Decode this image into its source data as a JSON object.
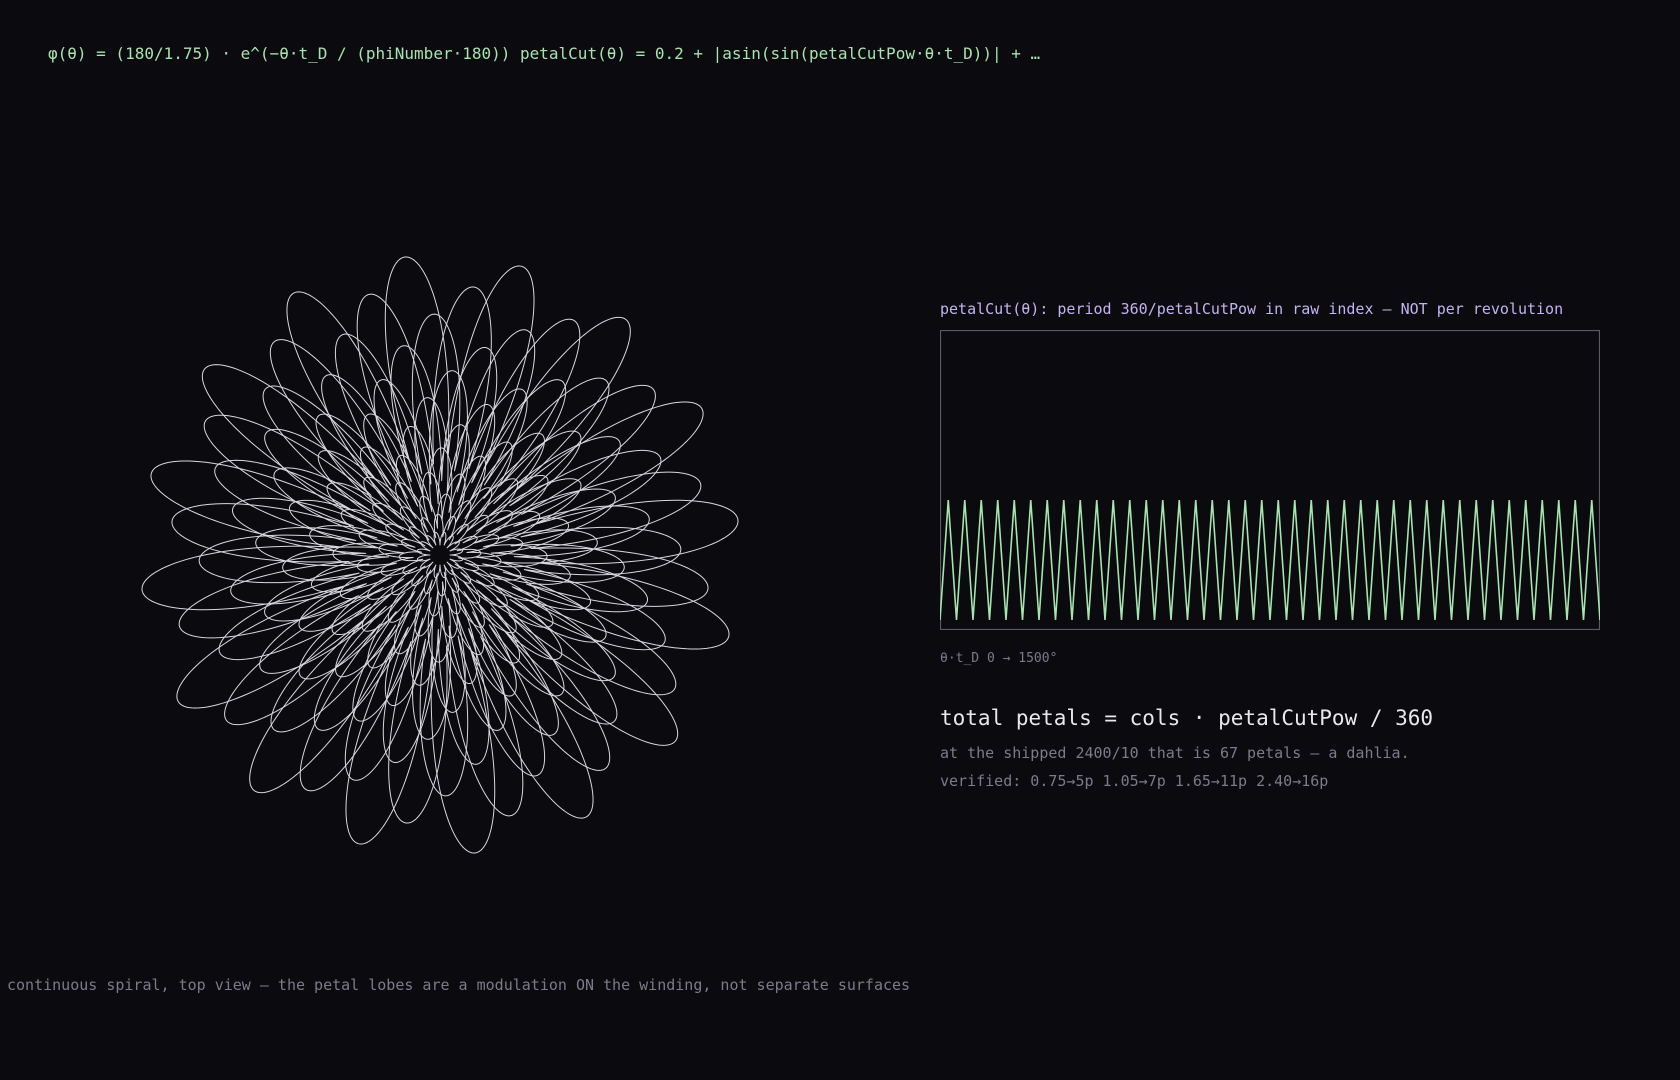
{
  "colors": {
    "background": "#0b0a0f",
    "formula_green": "#a6e3b0",
    "flower_stroke": "#d8d8de",
    "panel_title_purple": "#c3b3f0",
    "wave_green": "#a6e3b0",
    "frame_gray": "#5a5a64",
    "muted_text": "#7d7a8a",
    "headline_text": "#e8e8ec"
  },
  "header": {
    "formula": "φ(θ) = (180/1.75) · e^(−θ·t_D / (phiNumber·180)) petalCut(θ) = 0.2 + |asin(sin(petalCutPow·θ·t_D))| + …"
  },
  "flower": {
    "layers": 12,
    "lobes_per_layer": 16
  },
  "caption": "continuous spiral, top view — the petal lobes are a modulation ON the winding, not separate surfaces",
  "panel": {
    "title": "petalCut(θ): period 360/petalCutPow in raw index — NOT per revolution",
    "axis_note": "θ·t_D 0 → 1500°",
    "headline": "total petals = cols · petalCutPow / 360",
    "sub1": "at the shipped 2400/10 that is 67 petals — a dahlia.",
    "sub2": "verified: 0.75→5p 1.05→7p 1.65→11p 2.40→16p"
  },
  "chart_data": {
    "type": "line",
    "title": "petalCut(θ): period 360/petalCutPow in raw index — NOT per revolution",
    "xlabel": "θ·t_D 0 → 1500°",
    "ylabel": "",
    "x_range": [
      0,
      1500
    ],
    "cycles": 40,
    "grid": false,
    "series": [
      {
        "function": "0.2 + |asin(sin(petalCutPow·θ·t_D))|"
      }
    ]
  }
}
